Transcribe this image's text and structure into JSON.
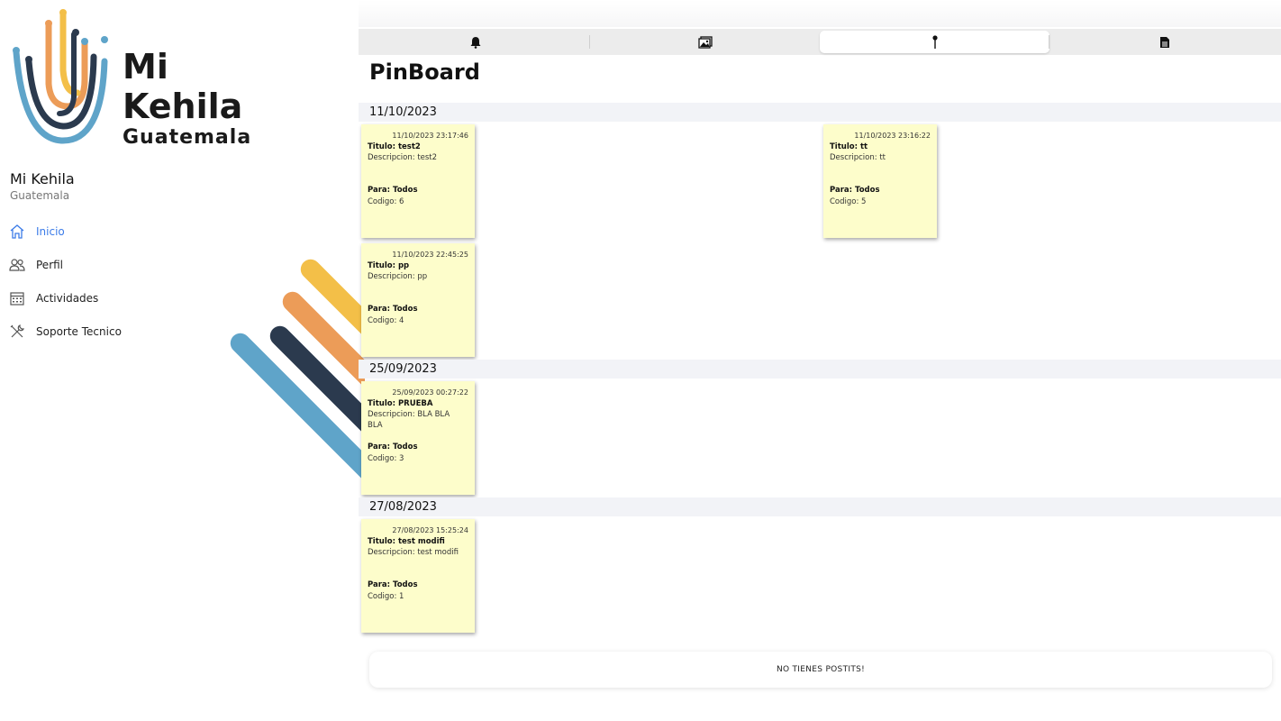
{
  "brand": {
    "logo_line1": "Mi",
    "logo_line2": "Kehila",
    "logo_line3": "Guatemala",
    "colors": {
      "blue": "#5fa4c9",
      "orange": "#ec9c58",
      "yellow": "#f3bf48",
      "navy": "#2b3a4e",
      "accent": "#3b7be8"
    }
  },
  "user": {
    "name": "Mi Kehila",
    "subtitle": "Guatemala"
  },
  "sidebar": {
    "items": [
      {
        "label": "Inicio",
        "icon": "home-icon",
        "active": true
      },
      {
        "label": "Perfil",
        "icon": "users-icon",
        "active": false
      },
      {
        "label": "Actividades",
        "icon": "calendar-icon",
        "active": false
      },
      {
        "label": "Soporte Tecnico",
        "icon": "tools-icon",
        "active": false
      }
    ]
  },
  "tabs": [
    {
      "icon": "bell-icon",
      "active": false
    },
    {
      "icon": "image-icon",
      "active": false
    },
    {
      "icon": "pin-icon",
      "active": true
    },
    {
      "icon": "document-icon",
      "active": false
    }
  ],
  "page": {
    "title": "PinBoard"
  },
  "sections": [
    {
      "date": "11/10/2023",
      "notes": [
        {
          "timestamp": "11/10/2023 23:17:46",
          "title": "Titulo: test2",
          "description": "Descripcion: test2",
          "para": "Para: Todos",
          "codigo": "Codigo: 6"
        },
        {
          "timestamp": "11/10/2023 23:16:22",
          "title": "Titulo: tt",
          "description": "Descripcion: tt",
          "para": "Para: Todos",
          "codigo": "Codigo: 5"
        },
        {
          "timestamp": "11/10/2023 22:45:25",
          "title": "Titulo: pp",
          "description": "Descripcion: pp",
          "para": "Para: Todos",
          "codigo": "Codigo: 4"
        }
      ]
    },
    {
      "date": "25/09/2023",
      "notes": [
        {
          "timestamp": "25/09/2023 00:27:22",
          "title": "Titulo: PRUEBA",
          "description": "Descripcion: BLA BLA BLA",
          "para": "Para: Todos",
          "codigo": "Codigo: 3"
        }
      ]
    },
    {
      "date": "27/08/2023",
      "notes": [
        {
          "timestamp": "27/08/2023 15:25:24",
          "title": "Titulo: test modifi",
          "description": "Descripcion: test modifi",
          "para": "Para: Todos",
          "codigo": "Codigo: 1"
        }
      ]
    }
  ],
  "footer": {
    "message": "NO TIENES POSTITS!"
  }
}
